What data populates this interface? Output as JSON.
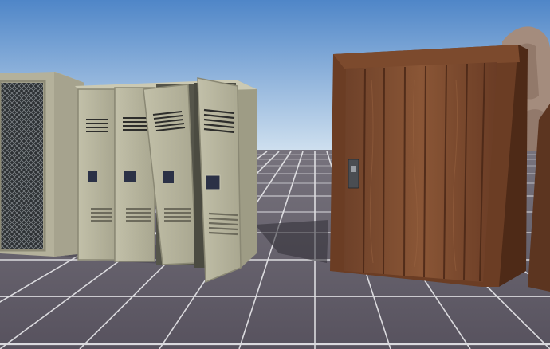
{
  "scene": {
    "description_type": "3d-game-viewport",
    "colors": {
      "sky_top": "#4f86c8",
      "sky_horizon": "#cfe0ef",
      "floor": "#5f5a66",
      "grid_lines": "#e9e9ec",
      "locker_paint": "#b9b7a0",
      "locker_shadow": "#8e8c77",
      "door_wood": "#7a4a2e",
      "door_frame": "#6b3d24",
      "rock": "#a48c7d"
    },
    "objects": [
      {
        "name": "cage-locker",
        "kind": "mesh-locker"
      },
      {
        "name": "gym-locker-bank",
        "kind": "locker-bank",
        "doors": 4,
        "open_doors": 2
      },
      {
        "name": "wooden-door",
        "kind": "door",
        "handle": "door-handle-plate"
      },
      {
        "name": "rock-formation",
        "kind": "terrain-rock"
      }
    ]
  }
}
